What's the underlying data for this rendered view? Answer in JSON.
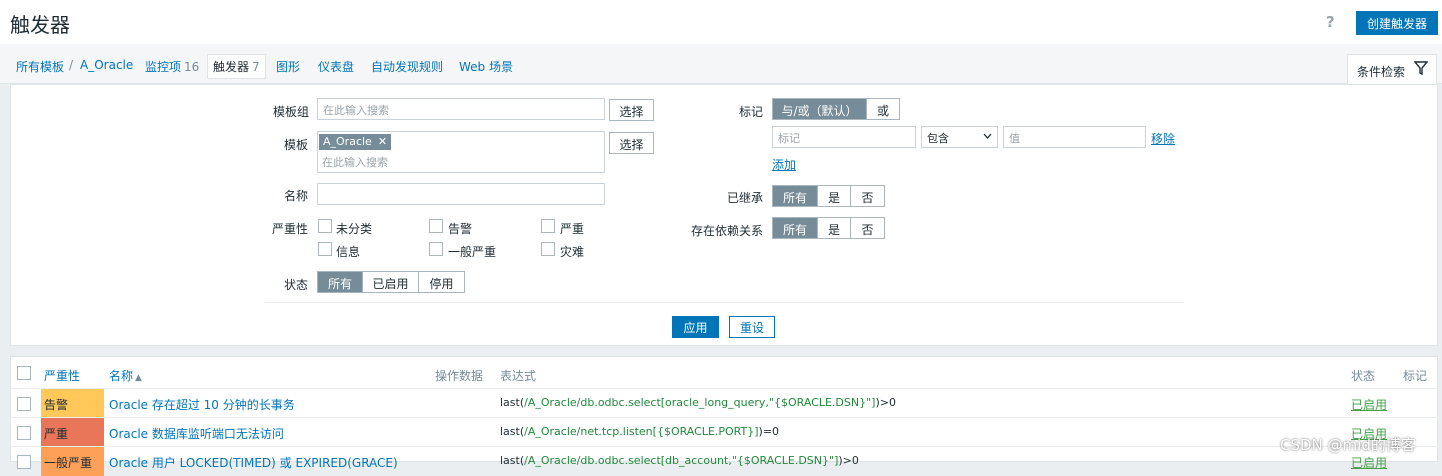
{
  "header": {
    "title": "触发器",
    "help": "?",
    "create_button": "创建触发器"
  },
  "breadcrumbs": [
    {
      "label": "所有模板",
      "count": ""
    },
    {
      "label": "A_Oracle",
      "count": ""
    },
    {
      "label": "监控项",
      "count": "16"
    },
    {
      "label": "触发器",
      "count": "7"
    },
    {
      "label": "图形",
      "count": ""
    },
    {
      "label": "仪表盘",
      "count": ""
    },
    {
      "label": "自动发现规则",
      "count": ""
    },
    {
      "label": "Web 场景",
      "count": ""
    }
  ],
  "breadcrumb_separator": "/",
  "filter_tab": {
    "label": "条件检索"
  },
  "filter": {
    "template_group": {
      "label": "模板组",
      "placeholder": "在此输入搜索",
      "select_button": "选择"
    },
    "template": {
      "label": "模板",
      "tag": "A_Oracle",
      "placeholder": "在此输入搜索",
      "select_button": "选择"
    },
    "name": {
      "label": "名称",
      "value": ""
    },
    "severity": {
      "label": "严重性",
      "options": [
        "未分类",
        "告警",
        "严重",
        "信息",
        "一般严重",
        "灾难"
      ]
    },
    "state": {
      "label": "状态",
      "options": [
        "所有",
        "已启用",
        "停用"
      ],
      "selected": "所有"
    },
    "tags": {
      "label": "标记",
      "mode_options": [
        "与/或（默认）",
        "或"
      ],
      "mode_selected": "与/或（默认）",
      "tag_placeholder": "标记",
      "operator": "包含",
      "value_placeholder": "值",
      "remove": "移除",
      "add": "添加"
    },
    "inherited": {
      "label": "已继承",
      "options": [
        "所有",
        "是",
        "否"
      ],
      "selected": "所有"
    },
    "dependencies": {
      "label": "存在依赖关系",
      "options": [
        "所有",
        "是",
        "否"
      ],
      "selected": "所有"
    },
    "apply": "应用",
    "reset": "重设"
  },
  "table": {
    "headers": {
      "severity": "严重性",
      "name": "名称",
      "sort_indicator": "▲",
      "operational_data": "操作数据",
      "expression": "表达式",
      "status": "状态",
      "tags": "标记"
    },
    "rows": [
      {
        "severity": "告警",
        "severity_color": "#ffc859",
        "name": "Oracle 存在超过 10 分钟的长事务",
        "expr_fn": "last(",
        "expr_item": "/A_Oracle/db.odbc.select[oracle_long_query,\"{$ORACLE.DSN}\"]",
        "expr_tail": ")>0",
        "status": "已启用"
      },
      {
        "severity": "严重",
        "severity_color": "#e97659",
        "name": "Oracle 数据库监听端口无法访问",
        "expr_fn": "last(",
        "expr_item": "/A_Oracle/net.tcp.listen[{$ORACLE.PORT}]",
        "expr_tail": ")=0",
        "status": "已启用"
      },
      {
        "severity": "一般严重",
        "severity_color": "#ffa059",
        "name": "Oracle 用户 LOCKED(TIMED) 或 EXPIRED(GRACE)",
        "expr_fn": "last(",
        "expr_item": "/A_Oracle/db.odbc.select[db_account,\"{$ORACLE.DSN}\"]",
        "expr_tail": ")>0",
        "status": "已启用"
      }
    ]
  },
  "watermark": "CSDN @mid的博客",
  "colors": {
    "accent": "#0275b8",
    "enabled": "#429e47"
  }
}
